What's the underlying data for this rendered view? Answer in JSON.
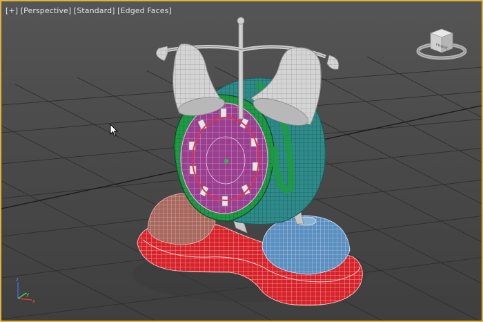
{
  "viewport": {
    "label_parts": [
      "[+]",
      "[Perspective]",
      "[Standard]",
      "[Edged Faces]"
    ],
    "border_color": "#e2b33a",
    "background_color": "#4b4b4b",
    "grid_color": "#2e2e2e"
  },
  "view_cube": {
    "face_label": "FRONT",
    "icon": "view-cube-icon"
  },
  "axis_gizmo": {
    "x": "x",
    "y": "y",
    "z": "z"
  },
  "model": {
    "name": "alarm clock",
    "colors": {
      "clock_face": "#9a3f8f",
      "rim": "#1e9a45",
      "body_back": "#2f8a8a",
      "bells": "#d9d9d9",
      "base": "#d8222a",
      "dome_left": "#a8685e",
      "dome_right": "#5b8fbf",
      "hand_ring": "#e0344a",
      "center_dot": "#22c04a"
    }
  }
}
